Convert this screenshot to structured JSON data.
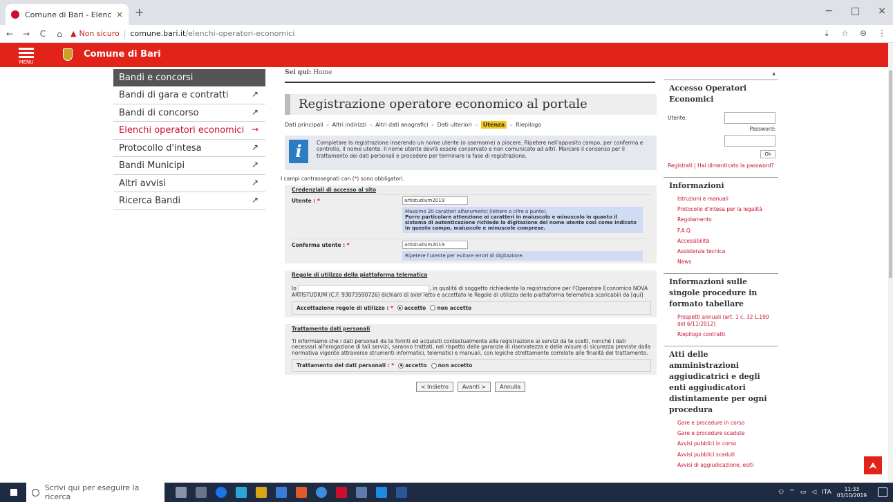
{
  "browser": {
    "tab_title": "Comune di Bari - Elenchi operat",
    "tab_close": "×",
    "new_tab": "+",
    "win_controls": [
      "−",
      "□",
      "×"
    ],
    "nav": [
      "←",
      "→",
      "C",
      "⌂"
    ],
    "not_secure": "Non sicuro",
    "url_domain": "comune.bari.it",
    "url_path": "/elenchi-operatori-economici",
    "addr_icons": [
      "⇣",
      "☆",
      "⊖",
      "⋮"
    ]
  },
  "header": {
    "menu_label": "MENU",
    "site_name": "Comune di Bari"
  },
  "leftnav": {
    "heading": "Bandi e concorsi",
    "items": [
      {
        "label": "Bandi di gara e contratti",
        "arrow": "↗"
      },
      {
        "label": "Bandi di concorso",
        "arrow": "↗"
      },
      {
        "label": "Elenchi operatori economici",
        "arrow": "→",
        "active": true
      },
      {
        "label": "Protocollo d'intesa",
        "arrow": "↗"
      },
      {
        "label": "Bandi Municipi",
        "arrow": "↗"
      },
      {
        "label": "Altri avvisi",
        "arrow": "↗"
      },
      {
        "label": "Ricerca Bandi",
        "arrow": "↗"
      }
    ]
  },
  "main": {
    "breadcrumb_label": "Sei qui:",
    "breadcrumb_home": "Home",
    "title": "Registrazione operatore economico al portale",
    "steps": [
      "Dati principali",
      "Altri indirizzi",
      "Altri dati anagrafici",
      "Dati ulteriori",
      "Utenza",
      "Riepilogo"
    ],
    "step_sep": "»",
    "info_icon": "i",
    "info_text": "Completare la registrazione inserendo un nome utente (o username) a piacere. Ripetere nell'apposito campo, per conferma e controllo, il nome utente. Il nome utente dovrà essere conservato e non comunicato ad altri. Marcare il consenso per il trattamento dei dati personali e procedere per terminare la fase di registrazione.",
    "oblig_pre": "I campi contrassegnati con (",
    "oblig_star": "*",
    "oblig_post": ") sono obbligatori.",
    "cred": {
      "title": "Credenziali di accesso al sito",
      "utente_label": "Utente :",
      "utente_value": "artistudium2019",
      "hint_line": "Massimo 20 caratteri alfanumerici (lettere o cifre o punto).",
      "hint_bold": "Porre particolare attenzione ai caratteri in maiuscolo e minuscolo in quanto il sistema di autenticazione richiede la digitazione del nome utente così come indicato in questo campo, maiuscole e minuscole comprese.",
      "conferma_label": "Conferma utente :",
      "conferma_value": "artistudium2019",
      "conferma_hint": "Ripetere l'utente per evitare errori di digitazione."
    },
    "regole": {
      "title": "Regole di utilizzo della piattaforma telematica",
      "io": "Io",
      "text": ", in qualità di soggetto richiedente la registrazione per l'Operatore Economico NOVA ARTISTUDIUM (C.F. 93073590726) dichiaro di aver letto e accettato le Regole di utilizzo della piattaforma telematica scaricabili da",
      "link": "[qui]",
      "label": "Accettazione regole di utilizzo :",
      "opt_yes": "accetto",
      "opt_no": "non accetto"
    },
    "privacy": {
      "title": "Trattamento dati personali",
      "text": "Ti informiamo che i dati personali da te forniti ed acquisiti contestualmente alla registrazione ai servizi da te scelti, nonché i dati necessari all'erogazione di tali servizi, saranno trattati, nel rispetto delle garanzie di riservatezza e delle misure di sicurezza previste dalla normativa vigente attraverso strumenti informatici, telematici e manuali, con logiche strettamente correlate alle finalità del trattamento.",
      "label": "Trattamento dei dati personali :",
      "opt_yes": "accetto",
      "opt_no": "non accetto"
    },
    "star": "*",
    "btn_back": "< Indietro",
    "btn_next": "Avanti >",
    "btn_cancel": "Annulla"
  },
  "sidebar": {
    "access_title": "Accesso Operatori Economici",
    "user_label": "Utente:",
    "pw_label": "Password:",
    "ok": "Ok",
    "register_links": "Registrati | Hai dimenticato la password?",
    "info_title": "Informazioni",
    "info_links": [
      "Istruzioni e manuali",
      "Protocollo d'intesa per la legalità",
      "Regolamento",
      "F.A.Q.",
      "Accessibilità",
      "Assistenza tecnica",
      "News"
    ],
    "tab_title": "Informazioni sulle singole procedure in formato tabellare",
    "tab_links": [
      "Prospetti annuali (art. 1 c. 32 L.190 del 6/11/2012)",
      "Riepilogo contratti"
    ],
    "atti_title": "Atti delle amministrazioni aggiudicatrici e degli enti aggiudicatori distintamente per ogni procedura",
    "atti_links": [
      "Gare e procedure in corso",
      "Gare e procedure scadute",
      "Avvisi pubblici in corso",
      "Avvisi pubblici scaduti",
      "Avvisi di aggiudicazione, esiti"
    ]
  },
  "totop": "⮝",
  "taskbar": {
    "search_placeholder": "Scrivi qui per eseguire la ricerca",
    "tray_text": "ITA",
    "time": "11:33",
    "date": "03/10/2019"
  }
}
